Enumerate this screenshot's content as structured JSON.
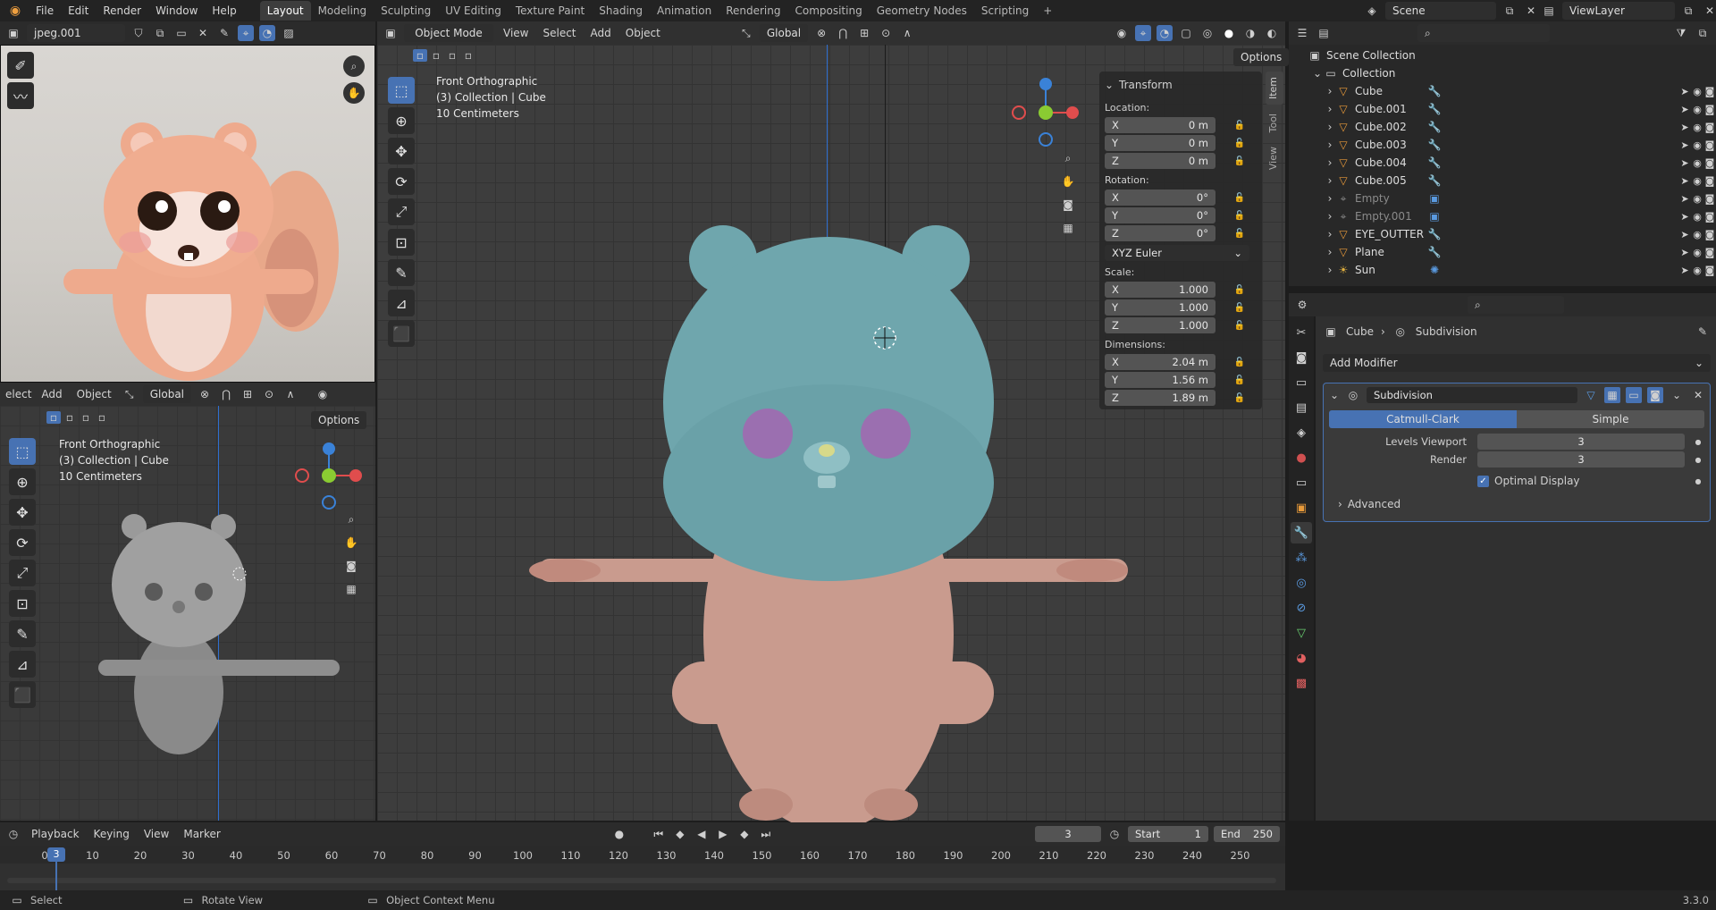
{
  "topbar": {
    "menus": [
      "File",
      "Edit",
      "Render",
      "Window",
      "Help"
    ],
    "workspaces": [
      "Layout",
      "Modeling",
      "Sculpting",
      "UV Editing",
      "Texture Paint",
      "Shading",
      "Animation",
      "Rendering",
      "Compositing",
      "Geometry Nodes",
      "Scripting"
    ],
    "active_workspace": "Layout",
    "add_tab": "+",
    "scene_label": "Scene",
    "viewlayer_label": "ViewLayer"
  },
  "image_editor": {
    "image_name": "jpeg.001"
  },
  "small_viewport": {
    "menus": [
      "elect",
      "Add",
      "Object"
    ],
    "orientation": "Global",
    "options_label": "Options",
    "info": [
      "Front Orthographic",
      "(3) Collection | Cube",
      "10 Centimeters"
    ]
  },
  "main_viewport": {
    "mode": "Object Mode",
    "menus": [
      "View",
      "Select",
      "Add",
      "Object"
    ],
    "orientation": "Global",
    "options_label": "Options",
    "info": [
      "Front Orthographic",
      "(3) Collection | Cube",
      "10 Centimeters"
    ],
    "side_tabs": [
      "Item",
      "Tool",
      "View"
    ]
  },
  "transform_panel": {
    "title": "Transform",
    "location_label": "Location:",
    "location": [
      {
        "axis": "X",
        "value": "0 m"
      },
      {
        "axis": "Y",
        "value": "0 m"
      },
      {
        "axis": "Z",
        "value": "0 m"
      }
    ],
    "rotation_label": "Rotation:",
    "rotation": [
      {
        "axis": "X",
        "value": "0°"
      },
      {
        "axis": "Y",
        "value": "0°"
      },
      {
        "axis": "Z",
        "value": "0°"
      }
    ],
    "rotation_mode": "XYZ Euler",
    "scale_label": "Scale:",
    "scale": [
      {
        "axis": "X",
        "value": "1.000"
      },
      {
        "axis": "Y",
        "value": "1.000"
      },
      {
        "axis": "Z",
        "value": "1.000"
      }
    ],
    "dimensions_label": "Dimensions:",
    "dimensions": [
      {
        "axis": "X",
        "value": "2.04 m"
      },
      {
        "axis": "Y",
        "value": "1.56 m"
      },
      {
        "axis": "Z",
        "value": "1.89 m"
      }
    ]
  },
  "outliner": {
    "root": "Scene Collection",
    "collection": "Collection",
    "items": [
      {
        "name": "Cube",
        "dim": false
      },
      {
        "name": "Cube.001",
        "dim": false
      },
      {
        "name": "Cube.002",
        "dim": false
      },
      {
        "name": "Cube.003",
        "dim": false
      },
      {
        "name": "Cube.004",
        "dim": false
      },
      {
        "name": "Cube.005",
        "dim": false
      },
      {
        "name": "Empty",
        "dim": true
      },
      {
        "name": "Empty.001",
        "dim": true
      },
      {
        "name": "EYE_OUTTER",
        "dim": false
      },
      {
        "name": "Plane",
        "dim": false
      },
      {
        "name": "Sun",
        "dim": false
      }
    ]
  },
  "properties": {
    "breadcrumb_object": "Cube",
    "breadcrumb_modifier": "Subdivision",
    "add_modifier": "Add Modifier",
    "modifier_name": "Subdivision",
    "mode_catmull": "Catmull-Clark",
    "mode_simple": "Simple",
    "levels_viewport_label": "Levels Viewport",
    "levels_viewport": "3",
    "render_label": "Render",
    "render": "3",
    "optimal_display": "Optimal Display",
    "advanced": "Advanced"
  },
  "timeline": {
    "menus": [
      "Playback",
      "Keying",
      "View",
      "Marker"
    ],
    "current_frame": "3",
    "start_label": "Start",
    "start": "1",
    "end_label": "End",
    "end": "250",
    "ruler": [
      "0",
      "10",
      "20",
      "30",
      "40",
      "50",
      "60",
      "70",
      "80",
      "90",
      "100",
      "110",
      "120",
      "130",
      "140",
      "150",
      "160",
      "170",
      "180",
      "190",
      "200",
      "210",
      "220",
      "230",
      "240",
      "250"
    ],
    "playhead": "3"
  },
  "statusbar": {
    "select": "Select",
    "rotate": "Rotate View",
    "context": "Object Context Menu",
    "version": "3.3.0"
  },
  "colors": {
    "accent": "#4772b3",
    "head": "#6fa6ad",
    "body": "#c99b8e",
    "eyes": "#9b6fb0",
    "x_axis": "#e04d4d",
    "y_axis": "#8acb32",
    "z_axis": "#3a82d8"
  }
}
